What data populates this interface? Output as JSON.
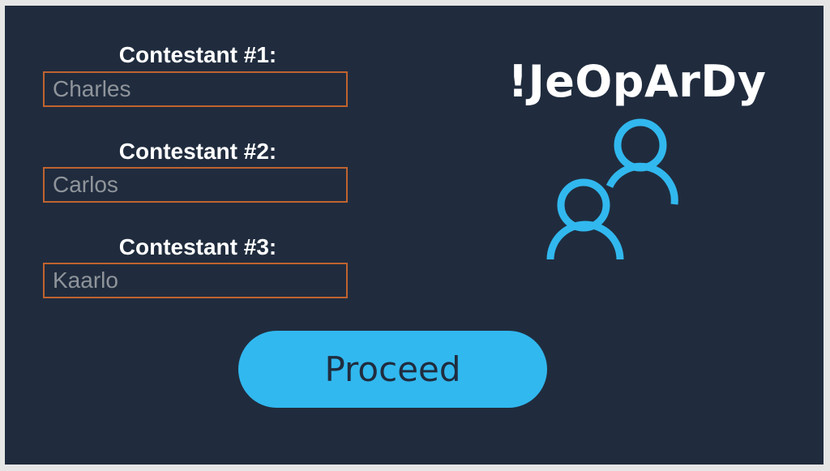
{
  "contestants": [
    {
      "label": "Contestant #1:",
      "value": "Charles"
    },
    {
      "label": "Contestant #2:",
      "value": "Carlos"
    },
    {
      "label": "Contestant #3:",
      "value": "Kaarlo"
    }
  ],
  "title": "!JeOpArDy",
  "proceed_label": "Proceed",
  "icons": {
    "people": "people-icon"
  },
  "colors": {
    "background": "#202c3e",
    "accent": "#31b8ef",
    "field_border": "#c0632f",
    "field_text": "#8f949a"
  }
}
